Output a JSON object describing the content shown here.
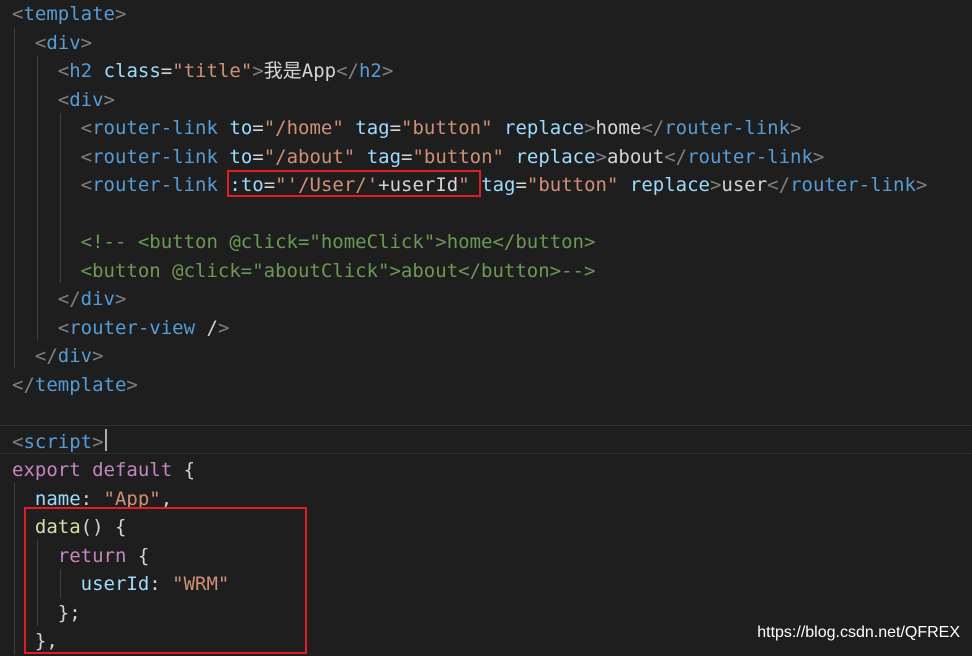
{
  "code_lines": [
    [
      [
        "punc",
        "<"
      ],
      [
        "tag",
        "template"
      ],
      [
        "punc",
        ">"
      ]
    ],
    [
      [
        "text",
        "  "
      ],
      [
        "punc",
        "<"
      ],
      [
        "tag",
        "div"
      ],
      [
        "punc",
        ">"
      ]
    ],
    [
      [
        "text",
        "    "
      ],
      [
        "punc",
        "<"
      ],
      [
        "tag",
        "h2"
      ],
      [
        "text",
        " "
      ],
      [
        "attr",
        "class"
      ],
      [
        "text",
        "="
      ],
      [
        "str",
        "\"title\""
      ],
      [
        "punc",
        ">"
      ],
      [
        "text",
        "我是App"
      ],
      [
        "punc",
        "</"
      ],
      [
        "tag",
        "h2"
      ],
      [
        "punc",
        ">"
      ]
    ],
    [
      [
        "text",
        "    "
      ],
      [
        "punc",
        "<"
      ],
      [
        "tag",
        "div"
      ],
      [
        "punc",
        ">"
      ]
    ],
    [
      [
        "text",
        "      "
      ],
      [
        "punc",
        "<"
      ],
      [
        "tag",
        "router-link"
      ],
      [
        "text",
        " "
      ],
      [
        "attr",
        "to"
      ],
      [
        "text",
        "="
      ],
      [
        "str",
        "\"/home\""
      ],
      [
        "text",
        " "
      ],
      [
        "attr",
        "tag"
      ],
      [
        "text",
        "="
      ],
      [
        "str",
        "\"button\""
      ],
      [
        "text",
        " "
      ],
      [
        "attr",
        "replace"
      ],
      [
        "punc",
        ">"
      ],
      [
        "text",
        "home"
      ],
      [
        "punc",
        "</"
      ],
      [
        "tag",
        "router-link"
      ],
      [
        "punc",
        ">"
      ]
    ],
    [
      [
        "text",
        "      "
      ],
      [
        "punc",
        "<"
      ],
      [
        "tag",
        "router-link"
      ],
      [
        "text",
        " "
      ],
      [
        "attr",
        "to"
      ],
      [
        "text",
        "="
      ],
      [
        "str",
        "\"/about\""
      ],
      [
        "text",
        " "
      ],
      [
        "attr",
        "tag"
      ],
      [
        "text",
        "="
      ],
      [
        "str",
        "\"button\""
      ],
      [
        "text",
        " "
      ],
      [
        "attr",
        "replace"
      ],
      [
        "punc",
        ">"
      ],
      [
        "text",
        "about"
      ],
      [
        "punc",
        "</"
      ],
      [
        "tag",
        "router-link"
      ],
      [
        "punc",
        ">"
      ]
    ],
    [
      [
        "text",
        "      "
      ],
      [
        "punc",
        "<"
      ],
      [
        "tag",
        "router-link"
      ],
      [
        "text",
        " "
      ],
      [
        "attr",
        ":to"
      ],
      [
        "text",
        "="
      ],
      [
        "str",
        "\""
      ],
      [
        "str",
        "'/User/'"
      ],
      [
        "text",
        "+userId"
      ],
      [
        "str",
        "\""
      ],
      [
        "text",
        " "
      ],
      [
        "attr",
        "tag"
      ],
      [
        "text",
        "="
      ],
      [
        "str",
        "\"button\""
      ],
      [
        "text",
        " "
      ],
      [
        "attr",
        "replace"
      ],
      [
        "punc",
        ">"
      ],
      [
        "text",
        "user"
      ],
      [
        "punc",
        "</"
      ],
      [
        "tag",
        "router-link"
      ],
      [
        "punc",
        ">"
      ]
    ],
    [],
    [
      [
        "text",
        "      "
      ],
      [
        "cmt",
        "<!-- <button @click=\"homeClick\">home</button>"
      ]
    ],
    [
      [
        "text",
        "      "
      ],
      [
        "cmt",
        "<button @click=\"aboutClick\">about</button>-->"
      ]
    ],
    [
      [
        "text",
        "    "
      ],
      [
        "punc",
        "</"
      ],
      [
        "tag",
        "div"
      ],
      [
        "punc",
        ">"
      ]
    ],
    [
      [
        "text",
        "    "
      ],
      [
        "punc",
        "<"
      ],
      [
        "tag",
        "router-view"
      ],
      [
        "text",
        " /"
      ],
      [
        "punc",
        ">"
      ]
    ],
    [
      [
        "text",
        "  "
      ],
      [
        "punc",
        "</"
      ],
      [
        "tag",
        "div"
      ],
      [
        "punc",
        ">"
      ]
    ],
    [
      [
        "punc",
        "</"
      ],
      [
        "tag",
        "template"
      ],
      [
        "punc",
        ">"
      ]
    ],
    [],
    [
      [
        "punc",
        "<"
      ],
      [
        "tag",
        "script"
      ],
      [
        "punc",
        ">"
      ]
    ],
    [
      [
        "kw",
        "export"
      ],
      [
        "text",
        " "
      ],
      [
        "kw",
        "default"
      ],
      [
        "text",
        " {"
      ]
    ],
    [
      [
        "text",
        "  "
      ],
      [
        "prop",
        "name"
      ],
      [
        "text",
        ": "
      ],
      [
        "str",
        "\"App\""
      ],
      [
        "text",
        ","
      ]
    ],
    [
      [
        "text",
        "  "
      ],
      [
        "fn",
        "data"
      ],
      [
        "text",
        "() {"
      ]
    ],
    [
      [
        "text",
        "    "
      ],
      [
        "kw",
        "return"
      ],
      [
        "text",
        " {"
      ]
    ],
    [
      [
        "text",
        "      "
      ],
      [
        "prop",
        "userId"
      ],
      [
        "text",
        ": "
      ],
      [
        "str",
        "\"WRM\""
      ]
    ],
    [
      [
        "text",
        "    "
      ],
      [
        "text",
        "};"
      ]
    ],
    [
      [
        "text",
        "  "
      ],
      [
        "text",
        "},"
      ]
    ]
  ],
  "watermark": "https://blog.csdn.net/QFREX"
}
